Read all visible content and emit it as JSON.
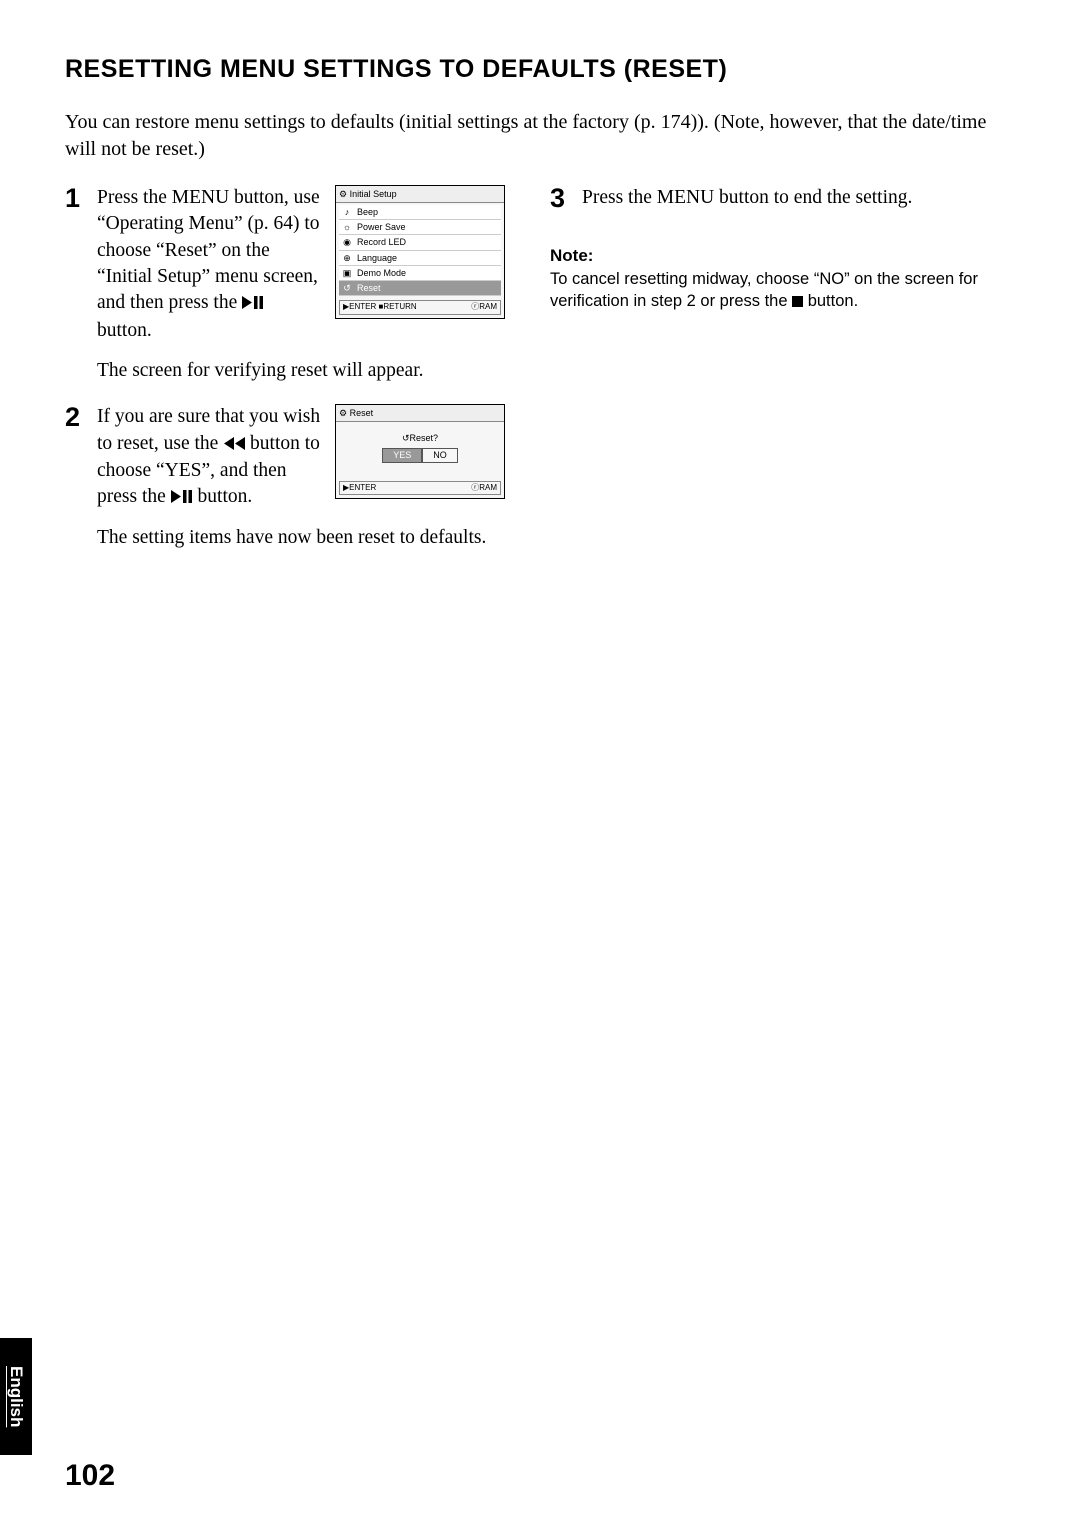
{
  "heading": "RESETTING MENU SETTINGS TO DEFAULTS (RESET)",
  "intro": "You can restore menu settings to defaults (initial settings at the factory (p. 174)). (Note, however, that the date/time will not be reset.)",
  "steps": {
    "s1": {
      "num": "1",
      "text_a": "Press the MENU button, use “Operating Menu” (p. 64) to choose “Reset” on the “Initial Setup” menu screen, and then press the ",
      "text_b": " button.",
      "result": "The screen for verifying reset will appear."
    },
    "s2": {
      "num": "2",
      "text_a": "If you are sure that you wish to reset, use the ",
      "text_b": " button to choose “YES”, and then press the ",
      "text_c": " button.",
      "result": "The setting items have now been reset to defaults."
    },
    "s3": {
      "num": "3",
      "text": "Press the MENU button to end the setting."
    }
  },
  "shot1": {
    "title": "Initial Setup",
    "items": [
      "Beep",
      "Power Save",
      "Record LED",
      "Language",
      "Demo Mode",
      "Reset"
    ],
    "footer_left": "▶ENTER  ■RETURN",
    "footer_right": "ⓡRAM"
  },
  "shot2": {
    "title": "Reset",
    "prompt": "Reset?",
    "yes": "YES",
    "no": "NO",
    "footer_left": "▶ENTER",
    "footer_right": "ⓡRAM"
  },
  "note": {
    "title": "Note:",
    "body_a": "To cancel resetting midway, choose “NO” on the screen for verification in step 2 or press the ",
    "body_b": " button."
  },
  "lang_tab": "English",
  "page_number": "102"
}
